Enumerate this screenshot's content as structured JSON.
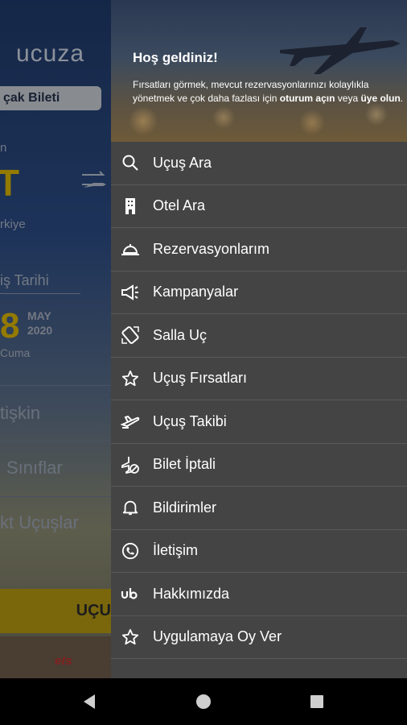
{
  "background": {
    "logo": "ucuza",
    "tab_label": "çak Bileti",
    "from_label": "n",
    "from_code": "T",
    "from_country": "rkiye",
    "date_label": "iş Tarihi",
    "date_day": "8",
    "date_month": "MAY",
    "date_year": "2020",
    "date_weekday": "Cuma",
    "passenger": "tişkin",
    "cabin": "Sınıflar",
    "direct": "kt Uçuşlar",
    "search_button": "UÇU",
    "banner": "ets"
  },
  "drawer": {
    "header": {
      "title": "Hoş geldiniz!",
      "desc_prefix": "Fırsatları görmek, mevcut rezervasyonlarınızı kolaylıkla yönetmek ve çok daha fazlası için ",
      "login_link": "oturum açın",
      "desc_middle": " veya ",
      "signup_link": "üye olun",
      "desc_suffix": "."
    },
    "items": [
      {
        "label": "Uçuş Ara",
        "icon": "search-icon"
      },
      {
        "label": "Otel Ara",
        "icon": "building-icon"
      },
      {
        "label": "Rezervasyonlarım",
        "icon": "cloche-icon"
      },
      {
        "label": "Kampanyalar",
        "icon": "megaphone-icon"
      },
      {
        "label": "Salla Uç",
        "icon": "shake-phone-icon"
      },
      {
        "label": "Uçuş Fırsatları",
        "icon": "star-icon"
      },
      {
        "label": "Uçuş Takibi",
        "icon": "plane-takeoff-icon"
      },
      {
        "label": "Bilet İptali",
        "icon": "plane-cancel-icon"
      },
      {
        "label": "Bildirimler",
        "icon": "bell-icon"
      },
      {
        "label": "İletişim",
        "icon": "phone-icon"
      },
      {
        "label": "Hakkımızda",
        "icon": "ub-logo-icon"
      },
      {
        "label": "Uygulamaya Oy Ver",
        "icon": "star-icon"
      }
    ]
  },
  "colors": {
    "drawer_bg": "#444444",
    "accent_yellow": "#d9b400",
    "divider": "#5a5a5a"
  }
}
